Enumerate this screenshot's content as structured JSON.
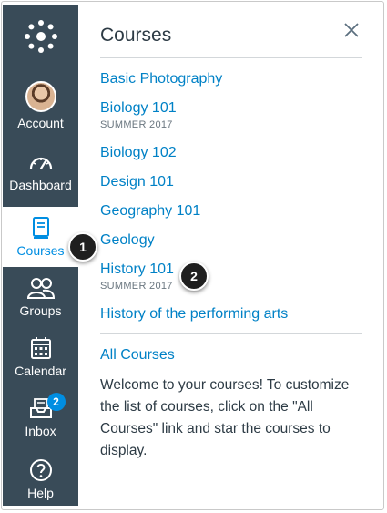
{
  "nav": {
    "items": [
      {
        "label": "Account",
        "icon": "avatar"
      },
      {
        "label": "Dashboard",
        "icon": "dashboard-icon"
      },
      {
        "label": "Courses",
        "icon": "courses-icon",
        "active": true
      },
      {
        "label": "Groups",
        "icon": "groups-icon"
      },
      {
        "label": "Calendar",
        "icon": "calendar-icon"
      },
      {
        "label": "Inbox",
        "icon": "inbox-icon",
        "badge": "2"
      },
      {
        "label": "Help",
        "icon": "help-icon"
      }
    ]
  },
  "tray": {
    "title": "Courses",
    "courses": [
      {
        "name": "Basic Photography"
      },
      {
        "name": "Biology 101",
        "term": "SUMMER 2017"
      },
      {
        "name": "Biology 102"
      },
      {
        "name": "Design 101"
      },
      {
        "name": "Geography 101"
      },
      {
        "name": "Geology"
      },
      {
        "name": "History 101",
        "term": "SUMMER 2017"
      },
      {
        "name": "History of the performing arts"
      }
    ],
    "all_courses": "All Courses",
    "welcome": "Welcome to your courses! To customize the list of courses, click on the \"All Courses\" link and star the courses to display."
  },
  "callouts": [
    "1",
    "2"
  ],
  "colors": {
    "nav_bg": "#394b58",
    "link": "#0081c6",
    "accent": "#008ee2"
  }
}
